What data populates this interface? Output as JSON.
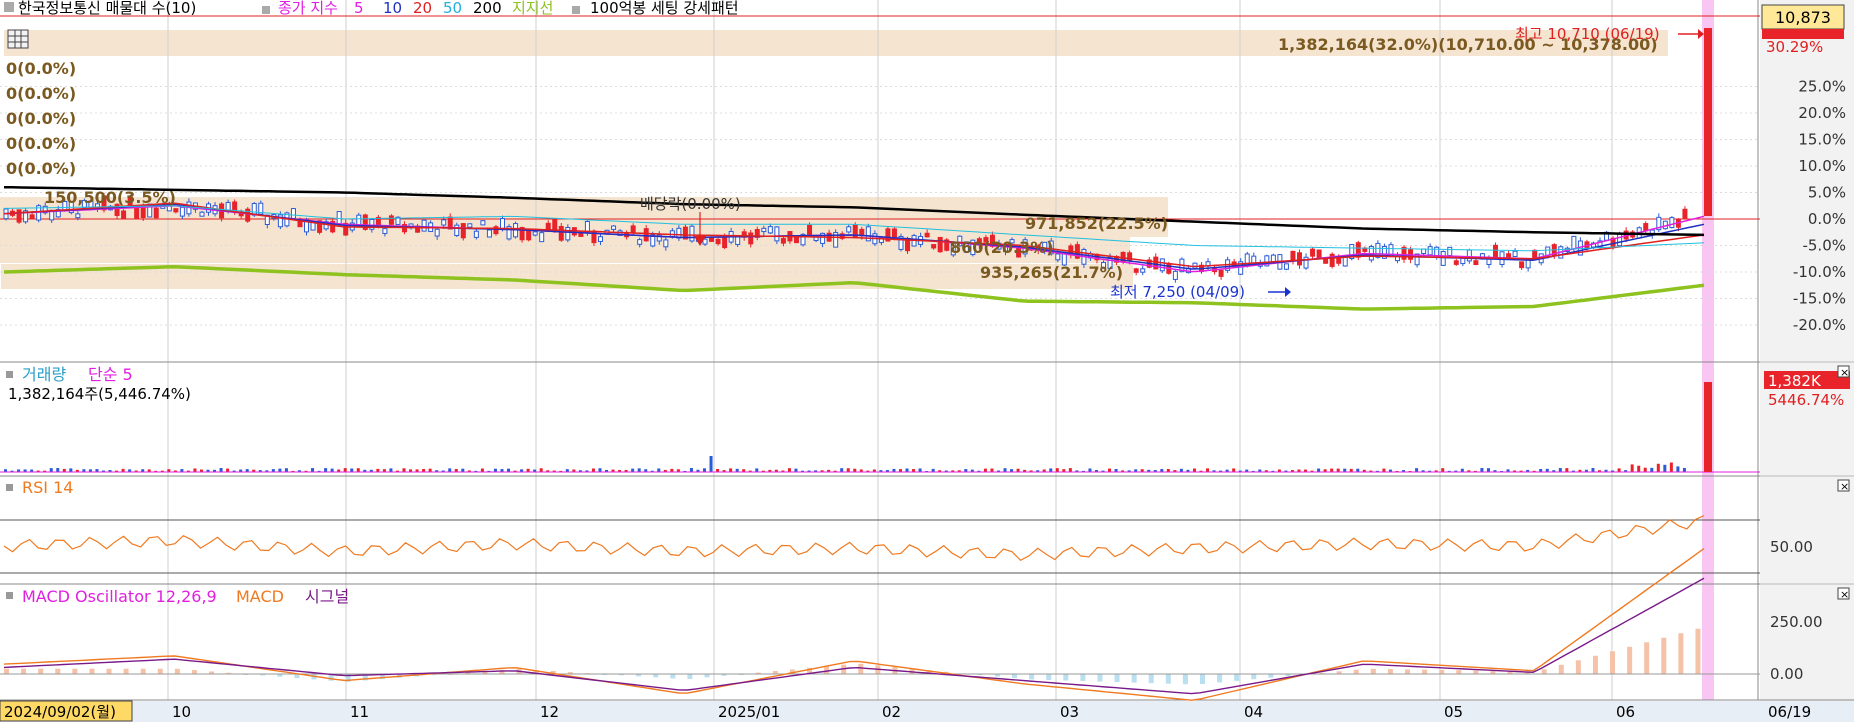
{
  "legend": {
    "stock_name": "한국정보통신 매물대 수(10)",
    "ma_label": "종가 지수",
    "ma_periods": [
      "5",
      "10",
      "20",
      "50",
      "200"
    ],
    "support_label": "지지선",
    "pattern_label": "100억봉 세팅 강세패턴"
  },
  "colors": {
    "up": "#e8232a",
    "down": "#2a5cd6",
    "ma5": "#e020e0",
    "ma10": "#2030c0",
    "ma20": "#e02020",
    "ma50": "#20c0e0",
    "ma200": "#000000",
    "support": "#8dc21f",
    "zone": "#f5e4cf",
    "rsi": "#f07a20",
    "macd": "#f07a20",
    "signal": "#7a1a8a",
    "osc": "#f5c2a8",
    "highlight": "#f7b6f0",
    "axis_text": "#333333"
  },
  "price_panel": {
    "current_price": "10,873",
    "right_pct_red": "30.29%",
    "y_tick_labels": [
      "25.0%",
      "20.0%",
      "15.0%",
      "10.0%",
      "5.0%",
      "0.0%",
      "-5.0%",
      "-10.0%",
      "-15.0%",
      "-20.0%"
    ],
    "y_tick_values": [
      25,
      20,
      15,
      10,
      5,
      0,
      -5,
      -10,
      -15,
      -20
    ],
    "zone_labels": [
      "0(0.0%)",
      "0(0.0%)",
      "0(0.0%)",
      "0(0.0%)",
      "0(0.0%)"
    ],
    "top_zone_label": "1,382,164(32.0%)(10,710.00 ~ 10,378.00)",
    "annotations": {
      "high": "최고 10,710 (06/19)",
      "low": "최저 7,250 (04/09)",
      "dividend": "배당락(0.00%)",
      "zone1": "150,500(3.5%)",
      "zone2": "971,852(22.5%)",
      "zone3": "860(20.3%)",
      "zone4": "935,265(21.7%)"
    }
  },
  "volume_panel": {
    "title": "거래량",
    "ma_label": "단순 5",
    "value_text": "1,382,164주(5,446.74%)",
    "badge_value": "1,382K",
    "badge_pct": "5446.74%"
  },
  "rsi_panel": {
    "title": "RSI 14",
    "y_tick_labels": [
      "50.00"
    ]
  },
  "macd_panel": {
    "title": "MACD Oscillator 12,26,9",
    "macd_label": "MACD",
    "signal_label": "시그널",
    "y_tick_labels": [
      "250.00",
      "0.00"
    ]
  },
  "x_axis": {
    "start_date": "2024/09/02(월)",
    "end_date": "06/19",
    "month_labels": [
      "10",
      "11",
      "12",
      "2025/01",
      "02",
      "03",
      "04",
      "05",
      "06"
    ]
  },
  "chart_data": [
    {
      "type": "candlestick",
      "title": "한국정보통신 매물대 수(10)",
      "x": [
        "2024/09",
        "10",
        "11",
        "12",
        "2025/01",
        "02",
        "03",
        "04",
        "05",
        "06",
        "06/19"
      ],
      "series": [
        {
          "name": "5",
          "values": [
            1.0,
            2.5,
            -1.0,
            -2.0,
            -3.5,
            -3.0,
            -5.5,
            -10.0,
            -6.5,
            -7.5,
            0.5
          ]
        },
        {
          "name": "10",
          "values": [
            1.0,
            2.8,
            -1.2,
            -2.0,
            -3.5,
            -3.0,
            -5.3,
            -9.5,
            -6.8,
            -7.8,
            -1.0
          ]
        },
        {
          "name": "20",
          "values": [
            1.0,
            3.0,
            -1.5,
            -1.8,
            -3.0,
            -3.5,
            -5.0,
            -9.0,
            -7.0,
            -7.5,
            -3.0
          ]
        },
        {
          "name": "50",
          "values": [
            2.0,
            2.5,
            0.0,
            0.5,
            -1.0,
            -1.0,
            -3.0,
            -5.0,
            -5.5,
            -6.0,
            -4.5
          ]
        },
        {
          "name": "200",
          "values": [
            6.0,
            5.5,
            5.0,
            4.0,
            2.8,
            2.2,
            0.8,
            -0.5,
            -1.8,
            -2.5,
            -3.0
          ]
        },
        {
          "name": "지지선",
          "values": [
            -10.0,
            -9.0,
            -10.5,
            -11.5,
            -13.5,
            -12.0,
            -15.5,
            -15.8,
            -17.0,
            -16.5,
            -12.5
          ]
        }
      ],
      "highlight": {
        "label": "최고 10,710 (06/19)",
        "low": "최저 7,250 (04/09)"
      },
      "ylim": [
        -22,
        30
      ]
    },
    {
      "type": "bar",
      "title": "거래량",
      "last_value": "1,382,164주(5,446.74%)"
    },
    {
      "type": "line",
      "title": "RSI 14",
      "y_guide_lines": [
        70,
        50,
        30
      ],
      "x": [
        "2024/09",
        "10",
        "11",
        "12",
        "2025/01",
        "02",
        "03",
        "04",
        "05",
        "06",
        "06/19"
      ],
      "values": [
        50,
        55,
        45,
        52,
        45,
        48,
        42,
        48,
        52,
        50,
        73
      ]
    },
    {
      "type": "line",
      "title": "MACD Oscillator 12,26,9",
      "x": [
        "2024/09",
        "10",
        "11",
        "12",
        "2025/01",
        "02",
        "03",
        "04",
        "05",
        "06",
        "06/19"
      ],
      "series": [
        {
          "name": "MACD",
          "values": [
            30,
            55,
            -20,
            20,
            -60,
            40,
            -30,
            -80,
            40,
            10,
            380
          ]
        },
        {
          "name": "시그널",
          "values": [
            20,
            45,
            -5,
            10,
            -50,
            20,
            -20,
            -60,
            30,
            5,
            290
          ]
        }
      ],
      "ylim": [
        -120,
        400
      ]
    }
  ]
}
